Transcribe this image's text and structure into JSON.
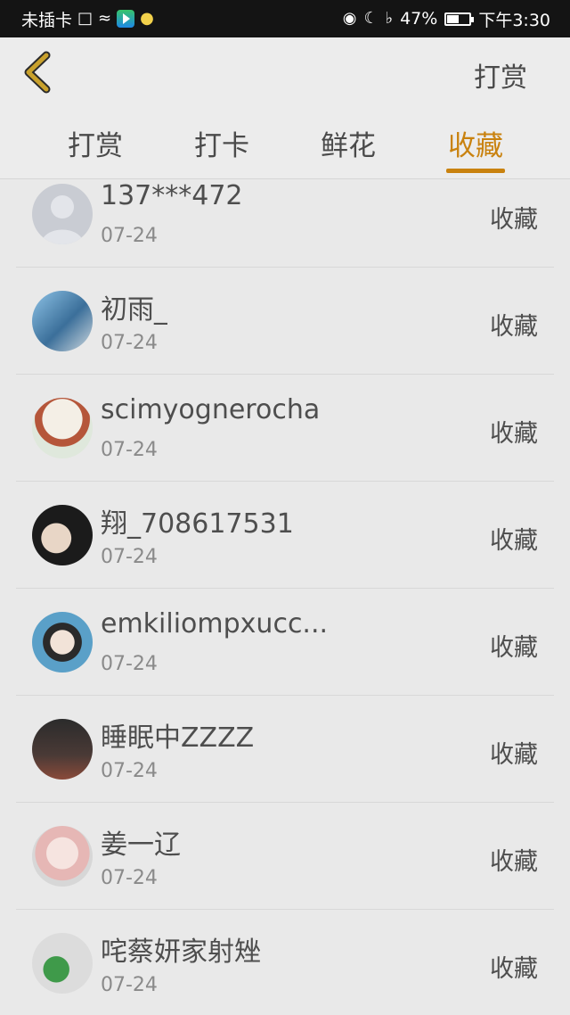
{
  "status_bar": {
    "carrier": "未插卡",
    "battery": "47%",
    "battery_level": 0.47,
    "time": "下午3:30",
    "icons": [
      "sim-alert-icon",
      "wifi-icon",
      "app-icon",
      "bulb-icon",
      "eye-icon",
      "moon-icon",
      "bell-off-icon",
      "battery-icon"
    ]
  },
  "header": {
    "back_icon": "chevron-left-icon",
    "action_label": "打赏"
  },
  "tabs": [
    {
      "label": "打赏",
      "active": false
    },
    {
      "label": "打卡",
      "active": false
    },
    {
      "label": "鲜花",
      "active": false
    },
    {
      "label": "收藏",
      "active": true
    }
  ],
  "colors": {
    "accent": "#c9820f",
    "text": "#4e4e4e",
    "muted": "#8a8a8a",
    "background": "#e9e9e9"
  },
  "list": [
    {
      "name": "137***472",
      "date": "07-24",
      "action": "收藏",
      "avatar": "default-avatar"
    },
    {
      "name": "初雨_",
      "date": "07-24",
      "action": "收藏",
      "avatar": "photo-avatar"
    },
    {
      "name": "scimyognerocha",
      "date": "07-24",
      "action": "收藏",
      "avatar": "illustration-avatar"
    },
    {
      "name": "翔_708617531",
      "date": "07-24",
      "action": "收藏",
      "avatar": "photo-avatar"
    },
    {
      "name": "emkiliompxucc...",
      "date": "07-24",
      "action": "收藏",
      "avatar": "illustration-avatar"
    },
    {
      "name": "睡眠中ZZZZ",
      "date": "07-24",
      "action": "收藏",
      "avatar": "photo-avatar"
    },
    {
      "name": "姜一辽",
      "date": "07-24",
      "action": "收藏",
      "avatar": "illustration-avatar"
    },
    {
      "name": "咤蔡妍家射矬",
      "date": "07-24",
      "action": "收藏",
      "avatar": "photo-avatar"
    }
  ]
}
